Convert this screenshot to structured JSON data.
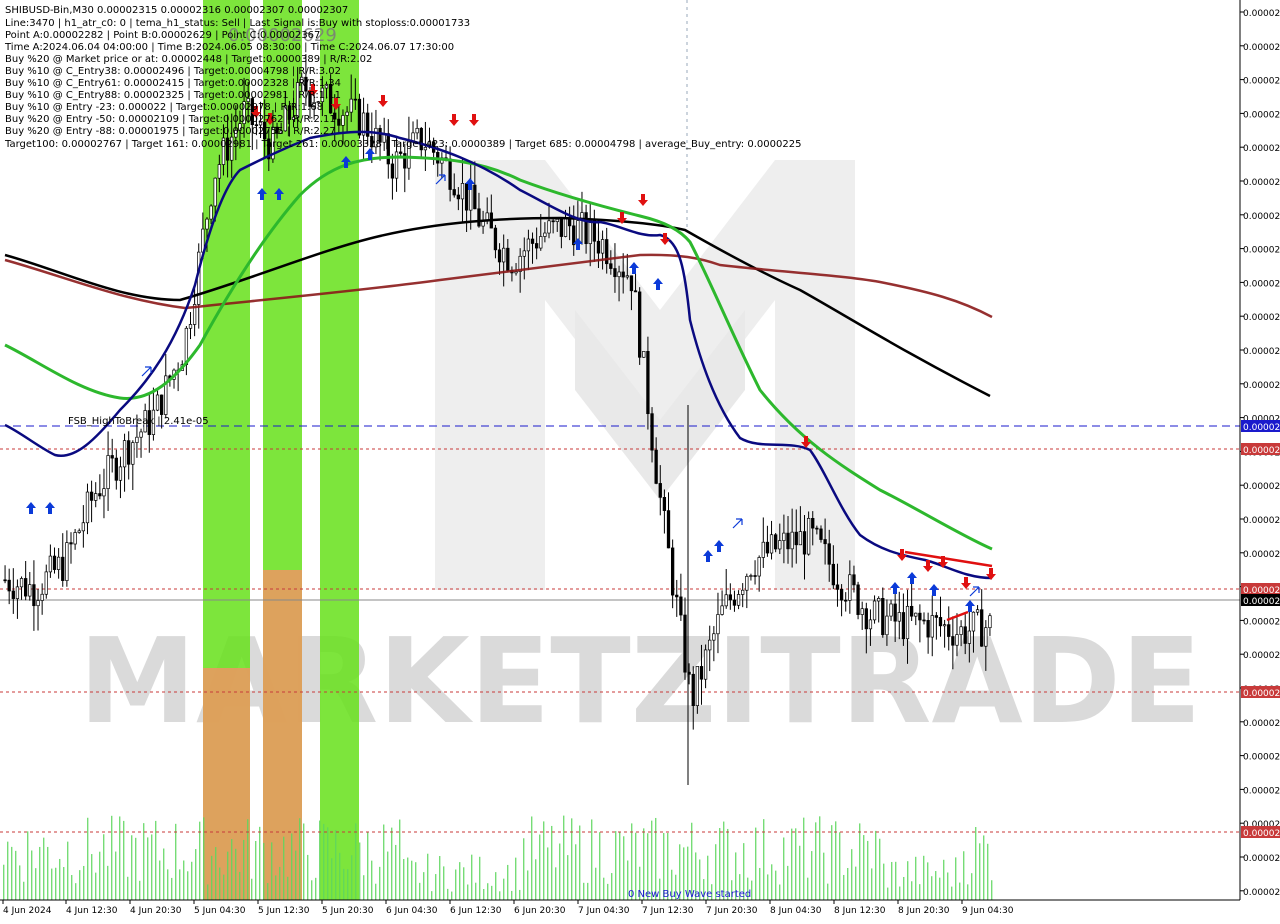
{
  "window": {
    "symbol_title": "SHIBUSD-Bin,M30  0.00002315 0.00002316 0.00002307 0.00002307",
    "big_price": "0.00002629"
  },
  "info_lines": [
    "Line:3470  |  h1_atr_c0: 0  |  tema_h1_status: Sell  |  Last Signal is:Buy with stoploss:0.00001733",
    "Point A:0.00002282  |  Point B:0.00002629  |  Point C:0.00002367",
    "Time A:2024.06.04 04:00:00  |  Time B:2024.06.05 08:30:00  |  Time C:2024.06.07 17:30:00",
    "Buy %20 @ Market price or at: 0.00002448  |  Target:0.0000389  |  R/R:2.02",
    "Buy %10 @ C_Entry38: 0.00002496  |  Target:0.00004798  |  R/R:3.02",
    "Buy %10 @ C_Entry61: 0.00002415  |  Target:0.00002328  |  R/R:1.34",
    "Buy %10 @ C_Entry88: 0.00002325  |  Target:0.00002981  |  R/R:1.11",
    "Buy %10 @ Entry -23: 0.000022  |  Target:0.00002978  |  R/R:1.68",
    "Buy %20 @ Entry -50: 0.00002109  |  Target:0.00002762  |  R/R:2.11",
    "Buy %20 @ Entry -88: 0.00001975  |  Target:0.00002755  |  R/R:2.27",
    "Target100: 0.00002767  |  Target 161: 0.00002981  |  Target 261: 0.00003328  |  Target 423: 0.0000389  |  Target 685: 0.00004798  |  average_Buy_entry: 0.0000225"
  ],
  "annotations": {
    "fsb_label": "FSB_HighToBreak | 2.41e-05",
    "wave_label": "0 New Buy Wave started",
    "watermark": "MARKETZITRADE"
  },
  "colors": {
    "background": "#ffffff",
    "plot_background": "#ffffff",
    "bull_candle": "#ffffff",
    "bear_candle": "#000000",
    "ema_fast": "#0a0a80",
    "ema_mid": "#2db82d",
    "ma_slow": "#8b1a1a",
    "ma_long": "#000000",
    "buy_arrow": "#0b3ad8",
    "sell_arrow": "#e01010",
    "zone_green": "#66e01a",
    "zone_orange": "#e89a60",
    "volume": "#5ed65e",
    "fsb_line": "#1a1acc",
    "level_red": "#c83a3a",
    "current_price_tag": "#000080"
  },
  "axis": {
    "price_labels": [
      "0.00002",
      "0.00002",
      "0.00002",
      "0.00002",
      "0.00002",
      "0.00002",
      "0.00002",
      "0.00002",
      "0.00002",
      "0.00002",
      "0.00002",
      "0.00002",
      "0.00002",
      "0.00002",
      "0.00002",
      "0.00002",
      "0.00002",
      "0.00002",
      "0.00002",
      "0.00002",
      "0.00002",
      "0.00002",
      "0.00002",
      "0.00002",
      "0.00002",
      "0.00002",
      "0.00002"
    ],
    "highlighted_labels": [
      {
        "text": "0.00002",
        "kind": "fsb"
      },
      {
        "text": "0.00002",
        "kind": "red"
      },
      {
        "text": "0.00002",
        "kind": "red"
      },
      {
        "text": "0.00002",
        "kind": "current"
      },
      {
        "text": "0.00002",
        "kind": "red"
      },
      {
        "text": "0.00002",
        "kind": "red"
      }
    ],
    "time_labels": [
      "4 Jun 2024",
      "4 Jun 12:30",
      "4 Jun 20:30",
      "5 Jun 04:30",
      "5 Jun 12:30",
      "5 Jun 20:30",
      "6 Jun 04:30",
      "6 Jun 12:30",
      "6 Jun 20:30",
      "7 Jun 04:30",
      "7 Jun 12:30",
      "7 Jun 20:30",
      "8 Jun 04:30",
      "8 Jun 12:30",
      "8 Jun 20:30",
      "9 Jun 04:30"
    ]
  },
  "chart_data": {
    "type": "candlestick",
    "symbol": "SHIBUSD-Bin",
    "timeframe": "M30",
    "x_range": [
      "4 Jun 2024",
      "9 Jun 04:30"
    ],
    "y_range": [
      1.99e-05,
      3.03e-05
    ],
    "last_bar": {
      "open": 2.315e-05,
      "high": 2.316e-05,
      "low": 2.307e-05,
      "close": 2.307e-05
    },
    "levels": {
      "fsb_high_to_break": 2.41e-05,
      "point_a": 2.282e-05,
      "point_b": 2.629e-05,
      "point_c": 2.367e-05
    },
    "close_path": [
      [
        "4 Jun 00:00",
        2.36e-05
      ],
      [
        "4 Jun 04:00",
        2.35e-05
      ],
      [
        "4 Jun 08:00",
        2.38e-05
      ],
      [
        "4 Jun 12:00",
        2.46e-05
      ],
      [
        "4 Jun 16:00",
        2.51e-05
      ],
      [
        "4 Jun 20:00",
        2.55e-05
      ],
      [
        "5 Jun 00:00",
        2.63e-05
      ],
      [
        "5 Jun 04:00",
        2.83e-05
      ],
      [
        "5 Jun 08:00",
        2.9e-05
      ],
      [
        "5 Jun 12:00",
        2.86e-05
      ],
      [
        "5 Jun 16:00",
        2.93e-05
      ],
      [
        "5 Jun 20:00",
        2.91e-05
      ],
      [
        "6 Jun 00:00",
        2.89e-05
      ],
      [
        "6 Jun 04:00",
        2.84e-05
      ],
      [
        "6 Jun 08:00",
        2.87e-05
      ],
      [
        "6 Jun 12:00",
        2.83e-05
      ],
      [
        "6 Jun 16:00",
        2.77e-05
      ],
      [
        "6 Jun 20:00",
        2.73e-05
      ],
      [
        "7 Jun 00:00",
        2.76e-05
      ],
      [
        "7 Jun 04:00",
        2.77e-05
      ],
      [
        "7 Jun 08:00",
        2.75e-05
      ],
      [
        "7 Jun 12:00",
        2.71e-05
      ],
      [
        "7 Jun 13:00",
        2.44e-05
      ],
      [
        "7 Jun 14:00",
        2.22e-05
      ],
      [
        "7 Jun 16:00",
        2.32e-05
      ],
      [
        "7 Jun 20:00",
        2.38e-05
      ],
      [
        "8 Jun 00:00",
        2.4e-05
      ],
      [
        "8 Jun 04:00",
        2.41e-05
      ],
      [
        "8 Jun 08:00",
        2.36e-05
      ],
      [
        "8 Jun 12:00",
        2.32e-05
      ],
      [
        "8 Jun 16:00",
        2.31e-05
      ],
      [
        "8 Jun 20:00",
        2.31e-05
      ],
      [
        "9 Jun 00:00",
        2.3e-05
      ],
      [
        "9 Jun 04:30",
        2.307e-05
      ]
    ]
  }
}
